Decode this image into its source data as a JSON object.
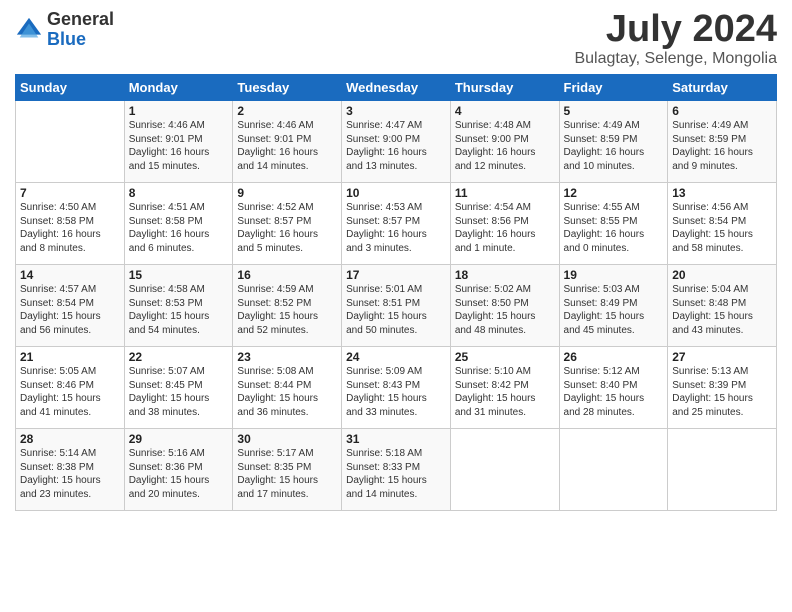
{
  "logo": {
    "general": "General",
    "blue": "Blue"
  },
  "header": {
    "month": "July 2024",
    "location": "Bulagtay, Selenge, Mongolia"
  },
  "days_of_week": [
    "Sunday",
    "Monday",
    "Tuesday",
    "Wednesday",
    "Thursday",
    "Friday",
    "Saturday"
  ],
  "weeks": [
    [
      {
        "day": "",
        "content": ""
      },
      {
        "day": "1",
        "content": "Sunrise: 4:46 AM\nSunset: 9:01 PM\nDaylight: 16 hours and 15 minutes."
      },
      {
        "day": "2",
        "content": "Sunrise: 4:46 AM\nSunset: 9:01 PM\nDaylight: 16 hours and 14 minutes."
      },
      {
        "day": "3",
        "content": "Sunrise: 4:47 AM\nSunset: 9:00 PM\nDaylight: 16 hours and 13 minutes."
      },
      {
        "day": "4",
        "content": "Sunrise: 4:48 AM\nSunset: 9:00 PM\nDaylight: 16 hours and 12 minutes."
      },
      {
        "day": "5",
        "content": "Sunrise: 4:49 AM\nSunset: 8:59 PM\nDaylight: 16 hours and 10 minutes."
      },
      {
        "day": "6",
        "content": "Sunrise: 4:49 AM\nSunset: 8:59 PM\nDaylight: 16 hours and 9 minutes."
      }
    ],
    [
      {
        "day": "7",
        "content": "Sunrise: 4:50 AM\nSunset: 8:58 PM\nDaylight: 16 hours and 8 minutes."
      },
      {
        "day": "8",
        "content": "Sunrise: 4:51 AM\nSunset: 8:58 PM\nDaylight: 16 hours and 6 minutes."
      },
      {
        "day": "9",
        "content": "Sunrise: 4:52 AM\nSunset: 8:57 PM\nDaylight: 16 hours and 5 minutes."
      },
      {
        "day": "10",
        "content": "Sunrise: 4:53 AM\nSunset: 8:57 PM\nDaylight: 16 hours and 3 minutes."
      },
      {
        "day": "11",
        "content": "Sunrise: 4:54 AM\nSunset: 8:56 PM\nDaylight: 16 hours and 1 minute."
      },
      {
        "day": "12",
        "content": "Sunrise: 4:55 AM\nSunset: 8:55 PM\nDaylight: 16 hours and 0 minutes."
      },
      {
        "day": "13",
        "content": "Sunrise: 4:56 AM\nSunset: 8:54 PM\nDaylight: 15 hours and 58 minutes."
      }
    ],
    [
      {
        "day": "14",
        "content": "Sunrise: 4:57 AM\nSunset: 8:54 PM\nDaylight: 15 hours and 56 minutes."
      },
      {
        "day": "15",
        "content": "Sunrise: 4:58 AM\nSunset: 8:53 PM\nDaylight: 15 hours and 54 minutes."
      },
      {
        "day": "16",
        "content": "Sunrise: 4:59 AM\nSunset: 8:52 PM\nDaylight: 15 hours and 52 minutes."
      },
      {
        "day": "17",
        "content": "Sunrise: 5:01 AM\nSunset: 8:51 PM\nDaylight: 15 hours and 50 minutes."
      },
      {
        "day": "18",
        "content": "Sunrise: 5:02 AM\nSunset: 8:50 PM\nDaylight: 15 hours and 48 minutes."
      },
      {
        "day": "19",
        "content": "Sunrise: 5:03 AM\nSunset: 8:49 PM\nDaylight: 15 hours and 45 minutes."
      },
      {
        "day": "20",
        "content": "Sunrise: 5:04 AM\nSunset: 8:48 PM\nDaylight: 15 hours and 43 minutes."
      }
    ],
    [
      {
        "day": "21",
        "content": "Sunrise: 5:05 AM\nSunset: 8:46 PM\nDaylight: 15 hours and 41 minutes."
      },
      {
        "day": "22",
        "content": "Sunrise: 5:07 AM\nSunset: 8:45 PM\nDaylight: 15 hours and 38 minutes."
      },
      {
        "day": "23",
        "content": "Sunrise: 5:08 AM\nSunset: 8:44 PM\nDaylight: 15 hours and 36 minutes."
      },
      {
        "day": "24",
        "content": "Sunrise: 5:09 AM\nSunset: 8:43 PM\nDaylight: 15 hours and 33 minutes."
      },
      {
        "day": "25",
        "content": "Sunrise: 5:10 AM\nSunset: 8:42 PM\nDaylight: 15 hours and 31 minutes."
      },
      {
        "day": "26",
        "content": "Sunrise: 5:12 AM\nSunset: 8:40 PM\nDaylight: 15 hours and 28 minutes."
      },
      {
        "day": "27",
        "content": "Sunrise: 5:13 AM\nSunset: 8:39 PM\nDaylight: 15 hours and 25 minutes."
      }
    ],
    [
      {
        "day": "28",
        "content": "Sunrise: 5:14 AM\nSunset: 8:38 PM\nDaylight: 15 hours and 23 minutes."
      },
      {
        "day": "29",
        "content": "Sunrise: 5:16 AM\nSunset: 8:36 PM\nDaylight: 15 hours and 20 minutes."
      },
      {
        "day": "30",
        "content": "Sunrise: 5:17 AM\nSunset: 8:35 PM\nDaylight: 15 hours and 17 minutes."
      },
      {
        "day": "31",
        "content": "Sunrise: 5:18 AM\nSunset: 8:33 PM\nDaylight: 15 hours and 14 minutes."
      },
      {
        "day": "",
        "content": ""
      },
      {
        "day": "",
        "content": ""
      },
      {
        "day": "",
        "content": ""
      }
    ]
  ]
}
